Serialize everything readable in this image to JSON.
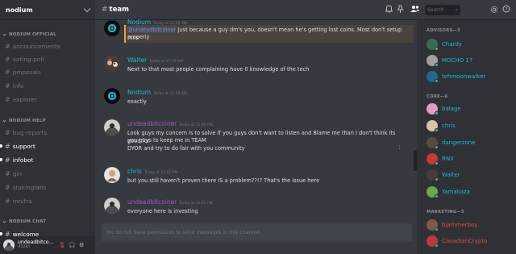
{
  "server": {
    "name": "nodium"
  },
  "sidebar": {
    "categories": [
      {
        "label": "NODIUM OFFICIAL"
      },
      {
        "label": "NODIUM HELP"
      },
      {
        "label": "NODIUM CHAT"
      }
    ],
    "channels": [
      {
        "label": "announcements",
        "unread": false
      },
      {
        "label": "voting-poll",
        "unread": false
      },
      {
        "label": "proposals",
        "unread": false
      },
      {
        "label": "info",
        "unread": false
      },
      {
        "label": "explorer",
        "unread": false
      },
      {
        "label": "bug-reports",
        "unread": false
      },
      {
        "label": "support",
        "unread": true
      },
      {
        "label": "infobot",
        "unread": true
      },
      {
        "label": "gin",
        "unread": false
      },
      {
        "label": "stakinglabs",
        "unread": false
      },
      {
        "label": "mnitra",
        "unread": false
      },
      {
        "label": "welcome",
        "unread": true
      }
    ]
  },
  "user_panel": {
    "name": "undeadbitco...",
    "discriminator": "#5285"
  },
  "topbar": {
    "channel": "team",
    "search_placeholder": "Search"
  },
  "messages": [
    {
      "author": "Nodium",
      "color": "#1fb8d6",
      "timestamp": "Today at 11:59 AM",
      "mention": "@undeadbitcoiner",
      "lines": [
        "Just because a guy dm's you, doesn't mean he's getting lost coins. Most don't setup mns",
        "properly"
      ]
    },
    {
      "author": "Walter",
      "color": "#1fb8d6",
      "timestamp": "Today at 11:59 AM",
      "lines": [
        "Next to that most people complaining have 0 knowledge of the tech"
      ]
    },
    {
      "author": "Nodium",
      "color": "#1fb8d6",
      "timestamp": "Today at 11:59 AM",
      "lines": [
        "exactly"
      ]
    },
    {
      "author": "undeadbitcoiner",
      "color": "#9b59b6",
      "timestamp": "Today at 12:00 PM",
      "lines": [
        "Look guys my concern is to solve If you guys don't want to listen and Blame me than I don't think its good for",
        "you guys to keep me in TEAM",
        "DYOR and try to do fair with you community"
      ]
    },
    {
      "author": "chris",
      "color": "#1fb8d6",
      "timestamp": "Today at 12:01 PM",
      "lines": [
        "but you still haven't proven there IS a problem??!? That's the issue here"
      ]
    },
    {
      "author": "undeadbitcoiner",
      "color": "#9b59b6",
      "timestamp": "Today at 12:01 PM",
      "lines": [
        "everyone here is investing"
      ]
    }
  ],
  "input": {
    "placeholder": "You do not have permission to send messages in this channel."
  },
  "members": {
    "roles": [
      {
        "label": "ADVISORS—3"
      },
      {
        "label": "CORE—6"
      },
      {
        "label": "MARKETING—5"
      }
    ],
    "list": [
      {
        "name": "Chardy",
        "color": "#1fb8d6"
      },
      {
        "name": "MOCHO 17",
        "color": "#1fb8d6"
      },
      {
        "name": "tehmoonwalker",
        "color": "#1fb8d6"
      },
      {
        "name": "balage",
        "color": "#1fb8d6"
      },
      {
        "name": "chris",
        "color": "#1fb8d6"
      },
      {
        "name": "dangerzone",
        "color": "#1fb8d6"
      },
      {
        "name": "RNX",
        "color": "#1fb8d6"
      },
      {
        "name": "Walter",
        "color": "#1fb8d6"
      },
      {
        "name": "Yamakaza",
        "color": "#1fb8d6"
      },
      {
        "name": "bjammerboy",
        "color": "#e74c3c"
      },
      {
        "name": "CanadianCrypto",
        "color": "#e74c3c"
      }
    ]
  }
}
